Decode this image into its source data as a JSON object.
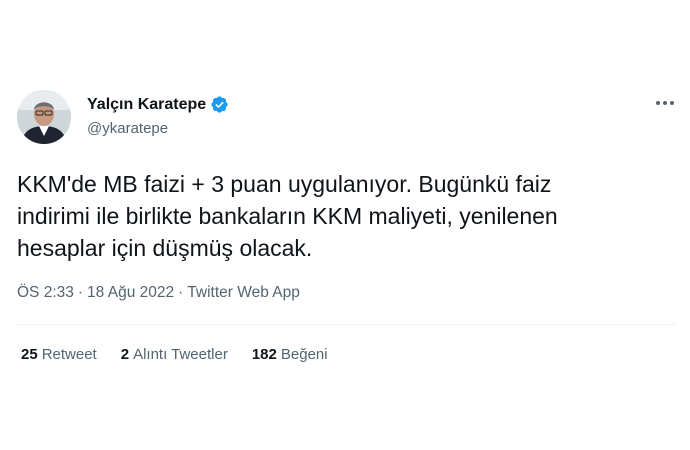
{
  "author": {
    "name": "Yalçın Karatepe",
    "handle": "@ykaratepe"
  },
  "tweet": {
    "text": "KKM'de MB faizi + 3 puan uygulanıyor. Bugünkü faiz\nindirimi ile birlikte bankaların KKM maliyeti, yenilenen\nhesaplar için düşmüş olacak."
  },
  "meta": {
    "time": "ÖS 2:33",
    "separator": "·",
    "date": "18 Ağu 2022",
    "source": "Twitter Web App"
  },
  "stats": {
    "retweets": {
      "count": "25",
      "label": "Retweet"
    },
    "quotes": {
      "count": "2",
      "label": "Alıntı Tweetler"
    },
    "likes": {
      "count": "182",
      "label": "Beğeni"
    }
  },
  "colors": {
    "verified": "#1d9bf0",
    "secondary_text": "#536471",
    "divider": "#eff3f4"
  },
  "icons": {
    "verified": "verified-badge-icon",
    "more": "more-options-icon"
  }
}
